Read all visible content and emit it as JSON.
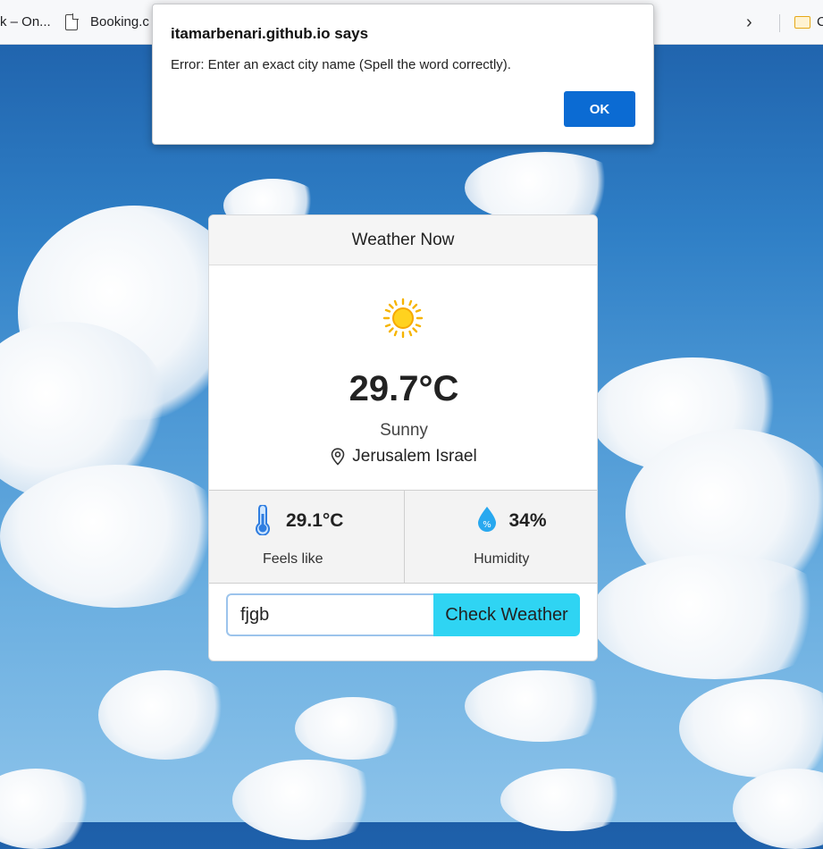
{
  "browser": {
    "bookmarks": [
      {
        "label": "k – On..."
      },
      {
        "label": "Booking.c"
      },
      {
        "label": "C"
      }
    ]
  },
  "dialog": {
    "title": "itamarbenari.github.io says",
    "message": "Error: Enter an exact city name (Spell the word correctly).",
    "ok_label": "OK"
  },
  "weather": {
    "header": "Weather Now",
    "icon": "sun-icon",
    "temperature": "29.7°C",
    "condition": "Sunny",
    "location": "Jerusalem Israel",
    "feels_like": {
      "value": "29.1°C",
      "label": "Feels like",
      "icon": "thermometer-icon"
    },
    "humidity": {
      "value": "34%",
      "label": "Humidity",
      "icon": "humidity-drop-icon"
    },
    "search": {
      "value": "fjgb",
      "button_label": "Check Weather"
    }
  },
  "colors": {
    "accent_button": "#2fd4f3",
    "dialog_ok": "#0b6bd3",
    "sky": "#2f7fc6"
  }
}
